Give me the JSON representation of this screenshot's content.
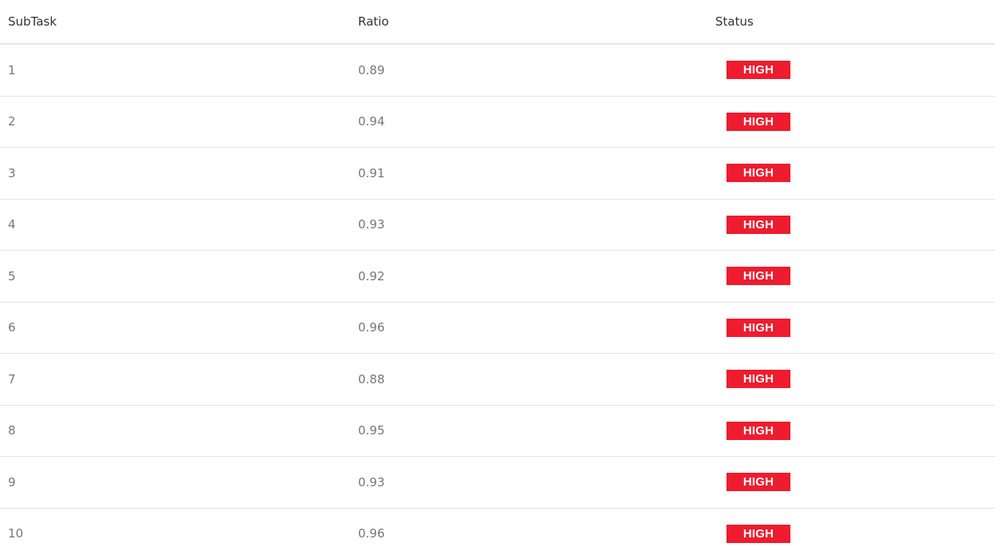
{
  "table": {
    "headers": [
      "SubTask",
      "Ratio",
      "Status"
    ],
    "rows": [
      {
        "subtask": "1",
        "ratio": "0.89",
        "status": "HIGH"
      },
      {
        "subtask": "2",
        "ratio": "0.94",
        "status": "HIGH"
      },
      {
        "subtask": "3",
        "ratio": "0.91",
        "status": "HIGH"
      },
      {
        "subtask": "4",
        "ratio": "0.93",
        "status": "HIGH"
      },
      {
        "subtask": "5",
        "ratio": "0.92",
        "status": "HIGH"
      },
      {
        "subtask": "6",
        "ratio": "0.96",
        "status": "HIGH"
      },
      {
        "subtask": "7",
        "ratio": "0.88",
        "status": "HIGH"
      },
      {
        "subtask": "8",
        "ratio": "0.95",
        "status": "HIGH"
      },
      {
        "subtask": "9",
        "ratio": "0.93",
        "status": "HIGH"
      },
      {
        "subtask": "10",
        "ratio": "0.96",
        "status": "HIGH"
      }
    ]
  },
  "colors": {
    "status_high": "#ee1c2e"
  }
}
